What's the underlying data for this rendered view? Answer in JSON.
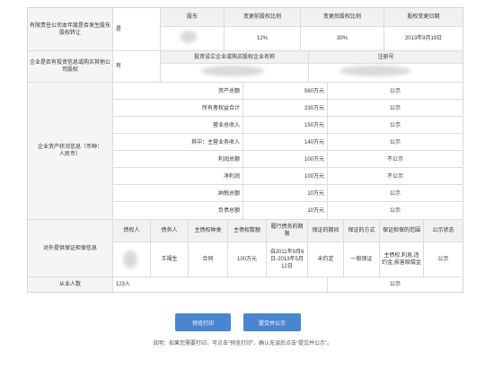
{
  "shareholder_transfer": {
    "question": "有限责任公司本年度是否发生股东股权转让",
    "answer": "是",
    "headers": [
      "股东",
      "变更前股权比例",
      "变更后股权比例",
      "股权变更日期"
    ],
    "row": {
      "shareholder": "",
      "before": "12%",
      "after": "30%",
      "date": "2013年9月19日"
    }
  },
  "investment": {
    "question": "企业是否有投资信息或购买其他公司股权",
    "answer": "有",
    "headers": [
      "投资设立企业或购买股权企业名称",
      "注册号"
    ]
  },
  "assets": {
    "label": "企业资产状况信息（币种：人民币）",
    "rows": [
      {
        "name": "资产总额",
        "value": "560万元",
        "status": "公示"
      },
      {
        "name": "所有者权益合计",
        "value": "230万元",
        "status": "公示"
      },
      {
        "name": "营业总收入",
        "value": "150万元",
        "status": "公示"
      },
      {
        "name": "其中：主营业务收入",
        "value": "140万元",
        "status": "公示"
      },
      {
        "name": "利润总额",
        "value": "100万元",
        "status": "不公示"
      },
      {
        "name": "净利润",
        "value": "100万元",
        "status": "不公示"
      },
      {
        "name": "纳税总额",
        "value": "10万元",
        "status": "公示"
      },
      {
        "name": "负债总额",
        "value": "10万元",
        "status": "公示"
      }
    ]
  },
  "guarantee": {
    "label": "对外提供保证担保信息",
    "headers": [
      "债权人",
      "债务人",
      "主债权种类",
      "主债权数额",
      "履行债务的期限",
      "保证的期间",
      "保证的方式",
      "保证担保的范围",
      "公示状态"
    ],
    "row": {
      "creditor": "",
      "debtor": "王福生",
      "type": "合同",
      "amount": "100万元",
      "term": "自2011年9月6日-2013年5月12日",
      "period": "未约定",
      "method": "一般保证",
      "scope": "主债权,利息,违约金,损害赔偿金",
      "status": "公示"
    }
  },
  "employees": {
    "label": "从业人数",
    "value": "123人",
    "status": "公示"
  },
  "buttons": {
    "preview": "预览打印",
    "submit": "提交并公示"
  },
  "note": "说明：如果您需要打印，可点击“预览打印”，确认无误后点击“提交并公示”。"
}
